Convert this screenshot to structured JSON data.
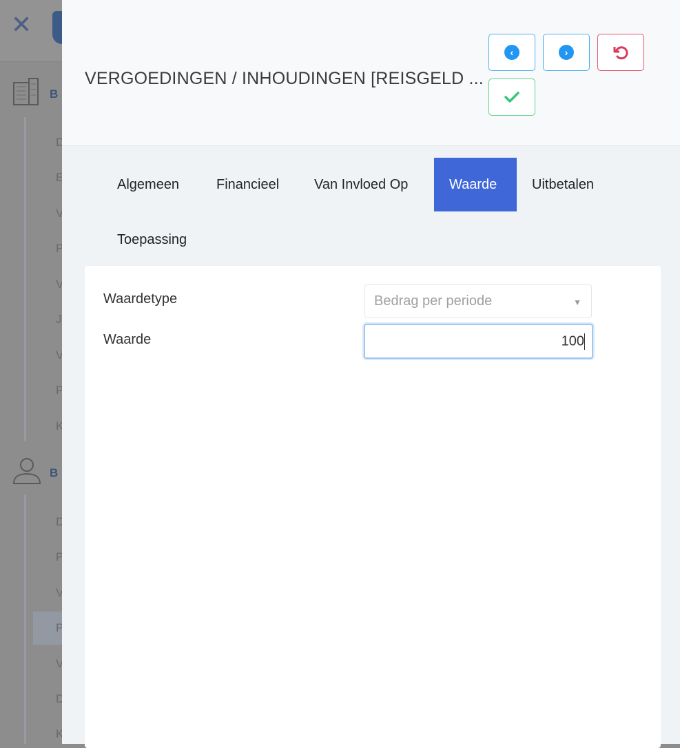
{
  "background": {
    "section1_label": "B",
    "section1_items": [
      "D",
      "E",
      "V",
      "P",
      "V",
      "J",
      "V",
      "P",
      "K"
    ],
    "section2_label": "B",
    "section2_items": [
      "D",
      "P",
      "V",
      "P",
      "V",
      "D",
      "K"
    ]
  },
  "header": {
    "title": "VERGOEDINGEN / INHOUDINGEN [REISGELD ..."
  },
  "tabs": [
    {
      "label": "Algemeen"
    },
    {
      "label": "Financieel"
    },
    {
      "label": "Van Invloed Op"
    },
    {
      "label": "Waarde",
      "active": true
    },
    {
      "label": "Uitbetalen"
    },
    {
      "label": "Toepassing"
    }
  ],
  "form": {
    "waardetype_label": "Waardetype",
    "waardetype_value": "Bedrag per periode",
    "waarde_label": "Waarde",
    "waarde_value": "100"
  },
  "colors": {
    "accent": "#3f67d8",
    "info": "#2196f3",
    "danger": "#e0506a",
    "success": "#3cc47a"
  }
}
